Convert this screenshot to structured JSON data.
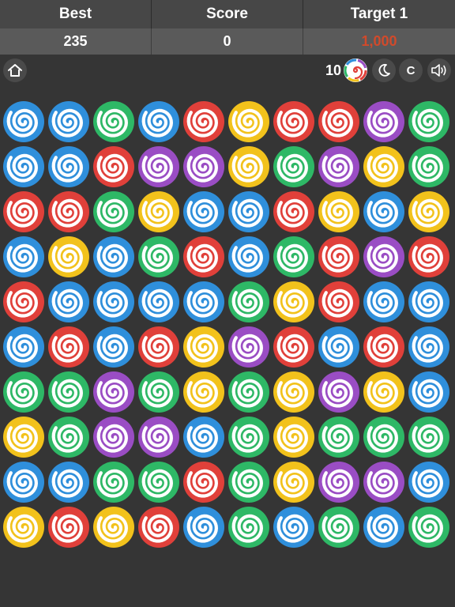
{
  "scoreboard": {
    "best_label": "Best",
    "best_value": "235",
    "score_label": "Score",
    "score_value": "0",
    "target_label": "Target 1",
    "target_value": "1,000",
    "target_color": "#d14a2b"
  },
  "toolbar": {
    "moves_remaining": "10",
    "c_label": "C",
    "icons": [
      "home-icon",
      "swirl-candy-icon",
      "moon-icon",
      "sound-icon"
    ]
  },
  "colors": {
    "blue": "#2f8fdb",
    "green": "#2eb866",
    "red": "#e0403a",
    "yellow": "#f2c21c",
    "purple": "#9a4dc4",
    "background": "#353535"
  },
  "board": {
    "rows": 10,
    "cols": 10,
    "grid": [
      [
        "blue",
        "blue",
        "green",
        "blue",
        "red",
        "yellow",
        "red",
        "red",
        "purple",
        "green"
      ],
      [
        "blue",
        "blue",
        "red",
        "purple",
        "purple",
        "yellow",
        "green",
        "purple",
        "yellow",
        "green"
      ],
      [
        "red",
        "red",
        "green",
        "yellow",
        "blue",
        "blue",
        "red",
        "yellow",
        "blue",
        "yellow"
      ],
      [
        "blue",
        "yellow",
        "blue",
        "green",
        "red",
        "blue",
        "green",
        "red",
        "purple",
        "red"
      ],
      [
        "red",
        "blue",
        "blue",
        "blue",
        "blue",
        "green",
        "yellow",
        "red",
        "blue",
        "blue"
      ],
      [
        "blue",
        "red",
        "blue",
        "red",
        "yellow",
        "purple",
        "red",
        "blue",
        "red",
        "blue"
      ],
      [
        "green",
        "green",
        "purple",
        "green",
        "yellow",
        "green",
        "yellow",
        "purple",
        "yellow",
        "blue"
      ],
      [
        "yellow",
        "green",
        "purple",
        "purple",
        "blue",
        "green",
        "yellow",
        "green",
        "green",
        "green"
      ],
      [
        "blue",
        "blue",
        "green",
        "green",
        "red",
        "green",
        "yellow",
        "purple",
        "purple",
        "blue"
      ],
      [
        "yellow",
        "red",
        "yellow",
        "red",
        "blue",
        "green",
        "blue",
        "green",
        "blue",
        "green"
      ]
    ]
  }
}
